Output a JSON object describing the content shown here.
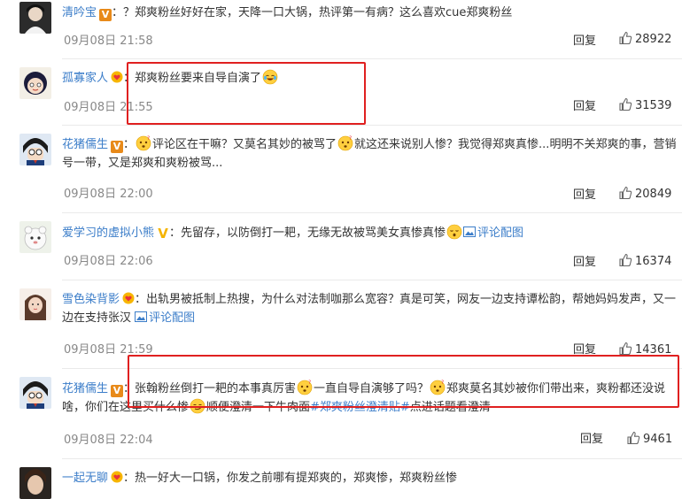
{
  "comments": [
    {
      "user": "清吟宝",
      "text": "：？郑爽粉丝好好在家，天降一口大锅，热评第一有病？这么喜欢cue郑爽粉丝",
      "time": "09月08日 21:58",
      "reply": "回复",
      "likes": "28922"
    },
    {
      "user": "孤寡家人",
      "text": "：郑爽粉丝要来自导自演了",
      "time": "09月08日 21:55",
      "reply": "回复",
      "likes": "31539"
    },
    {
      "user": "花猪儒生",
      "text_a": "：",
      "text_b": "评论区在干嘛？又莫名其妙的被骂了",
      "text_c": "就这还来说别人惨？我觉得郑爽真惨...明明不关郑爽的事，营销号一带，又是郑爽和爽粉被骂...",
      "time": "09月08日 22:00",
      "reply": "回复",
      "likes": "20849"
    },
    {
      "user": "爱学习的虚拟小熊",
      "text": "：先留存，以防倒打一耙，无缘无故被骂美女真惨真惨",
      "link": "评论配图",
      "time": "09月08日 22:06",
      "reply": "回复",
      "likes": "16374"
    },
    {
      "user": "雪色染背影",
      "text": "：出轨男被抵制上热搜，为什么对法制咖那么宽容？真是可笑，网友一边支持谭松韵，帮她妈妈发声，又一边在支持张汉",
      "link": "评论配图",
      "time": "09月08日 21:59",
      "reply": "回复",
      "likes": "14361"
    },
    {
      "user": "花猪儒生",
      "text_a": "：张翰粉丝倒打一耙的本事真厉害",
      "text_b": "一直自导自演够了吗？",
      "text_c": "郑爽莫名其妙被你们带出来，爽粉都还没说啥，你们在这里买什么惨",
      "text_d": "顺便澄清一下牛肉面",
      "hashtag": "#郑爽粉丝澄清贴#",
      "text_e": "点进话题看澄清",
      "time": "09月08日 22:04",
      "reply": "回复",
      "likes": "9461"
    },
    {
      "user": "一起无聊",
      "text": "：热一好大一口锅，你发之前哪有提郑爽的，郑爽惨，郑爽粉丝惨"
    }
  ],
  "colors": {
    "username": "#3b7dc9",
    "time": "#888888",
    "highlight_box": "#e02020"
  },
  "icons": {
    "like": "thumbs-up-icon",
    "vip": "vip-badge-icon",
    "image_link": "image-icon"
  }
}
